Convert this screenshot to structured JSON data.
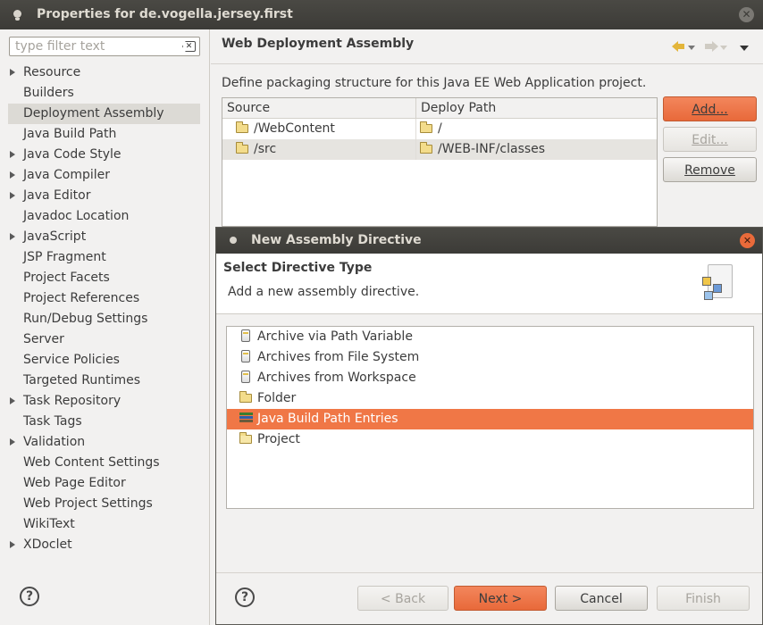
{
  "window": {
    "title": "Properties for de.vogella.jersey.first",
    "close_symbol": "✕"
  },
  "sidebar": {
    "filter_placeholder": "type filter text",
    "clear_symbol": "✕",
    "items": [
      {
        "label": "Resource",
        "expandable": true
      },
      {
        "label": "Builders",
        "expandable": false
      },
      {
        "label": "Deployment Assembly",
        "expandable": false,
        "selected": true
      },
      {
        "label": "Java Build Path",
        "expandable": false
      },
      {
        "label": "Java Code Style",
        "expandable": true
      },
      {
        "label": "Java Compiler",
        "expandable": true
      },
      {
        "label": "Java Editor",
        "expandable": true
      },
      {
        "label": "Javadoc Location",
        "expandable": false
      },
      {
        "label": "JavaScript",
        "expandable": true
      },
      {
        "label": "JSP Fragment",
        "expandable": false
      },
      {
        "label": "Project Facets",
        "expandable": false
      },
      {
        "label": "Project References",
        "expandable": false
      },
      {
        "label": "Run/Debug Settings",
        "expandable": false
      },
      {
        "label": "Server",
        "expandable": false
      },
      {
        "label": "Service Policies",
        "expandable": false
      },
      {
        "label": "Targeted Runtimes",
        "expandable": false
      },
      {
        "label": "Task Repository",
        "expandable": true
      },
      {
        "label": "Task Tags",
        "expandable": false
      },
      {
        "label": "Validation",
        "expandable": true
      },
      {
        "label": "Web Content Settings",
        "expandable": false
      },
      {
        "label": "Web Page Editor",
        "expandable": false
      },
      {
        "label": "Web Project Settings",
        "expandable": false
      },
      {
        "label": "WikiText",
        "expandable": false
      },
      {
        "label": "XDoclet",
        "expandable": true
      }
    ],
    "help_symbol": "?"
  },
  "main": {
    "title": "Web Deployment Assembly",
    "description": "Define packaging structure for this Java EE Web Application project.",
    "table": {
      "headers": [
        "Source",
        "Deploy Path"
      ],
      "rows": [
        {
          "source": "/WebContent",
          "deploy": "/"
        },
        {
          "source": "/src",
          "deploy": "/WEB-INF/classes"
        }
      ]
    },
    "buttons": {
      "add": "Add...",
      "edit": "Edit...",
      "remove": "Remove"
    }
  },
  "dialog": {
    "title": "New Assembly Directive",
    "close_symbol": "✕",
    "header_title": "Select Directive Type",
    "header_subtitle": "Add a new assembly directive.",
    "items": [
      {
        "label": "Archive via Path Variable",
        "icon": "jar-icon"
      },
      {
        "label": "Archives from File System",
        "icon": "jar-icon"
      },
      {
        "label": "Archives from Workspace",
        "icon": "jar-icon"
      },
      {
        "label": "Folder",
        "icon": "folder-icon"
      },
      {
        "label": "Java Build Path Entries",
        "icon": "library-icon",
        "selected": true
      },
      {
        "label": "Project",
        "icon": "open-folder-icon"
      }
    ],
    "help_symbol": "?",
    "buttons": {
      "back": "< Back",
      "next": "Next >",
      "cancel": "Cancel",
      "finish": "Finish"
    },
    "colors": {
      "selection": "#f07746",
      "primary_button": "#e8693a"
    }
  }
}
